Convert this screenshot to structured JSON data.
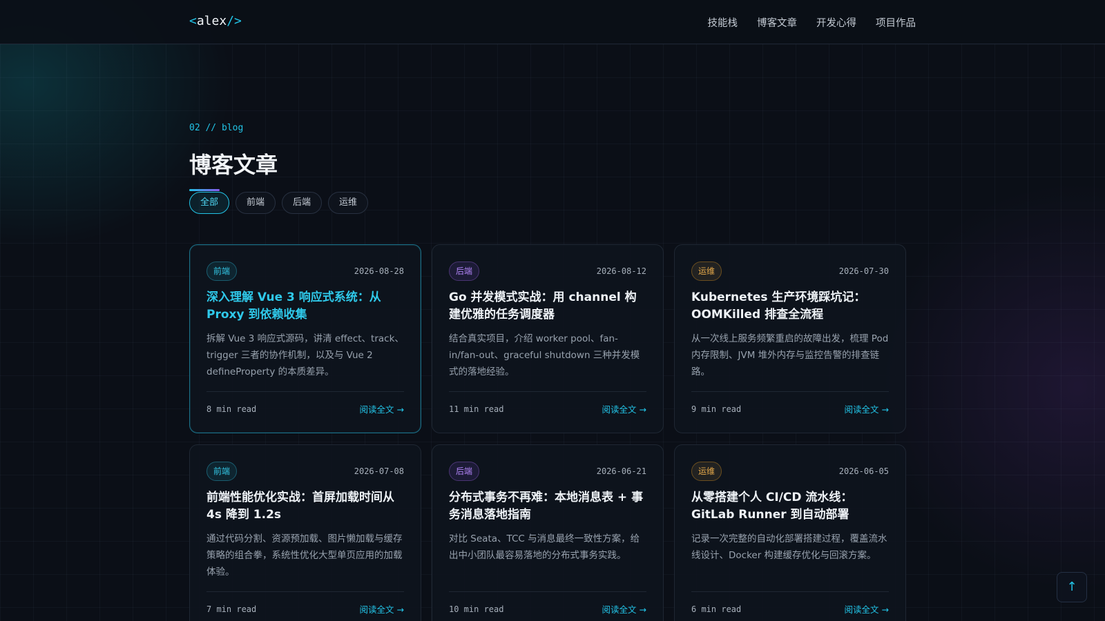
{
  "header": {
    "logo_open": "<",
    "logo_text": "alex",
    "logo_close": "/>",
    "nav": [
      "技能栈",
      "博客文章",
      "开发心得",
      "项目作品"
    ]
  },
  "section": {
    "kicker": "02 // blog",
    "title": "博客文章"
  },
  "filters": [
    {
      "label": "全部",
      "active": true
    },
    {
      "label": "前端",
      "active": false
    },
    {
      "label": "后端",
      "active": false
    },
    {
      "label": "运维",
      "active": false
    }
  ],
  "posts": [
    {
      "tag": "前端",
      "tag_kind": "fe",
      "date": "2026-08-28",
      "title": "深入理解 Vue 3 响应式系统：从 Proxy 到依赖收集",
      "desc": "拆解 Vue 3 响应式源码，讲清 effect、track、trigger 三者的协作机制，以及与 Vue 2 defineProperty 的本质差异。",
      "readtime": "8 min read",
      "readmore": "阅读全文 →",
      "featured": true
    },
    {
      "tag": "后端",
      "tag_kind": "be",
      "date": "2026-08-12",
      "title": "Go 并发模式实战：用 channel 构建优雅的任务调度器",
      "desc": "结合真实项目，介绍 worker pool、fan-in/fan-out、graceful shutdown 三种并发模式的落地经验。",
      "readtime": "11 min read",
      "readmore": "阅读全文 →",
      "featured": false
    },
    {
      "tag": "运维",
      "tag_kind": "ops",
      "date": "2026-07-30",
      "title": "Kubernetes 生产环境踩坑记：OOMKilled 排查全流程",
      "desc": "从一次线上服务频繁重启的故障出发，梳理 Pod 内存限制、JVM 堆外内存与监控告警的排查链路。",
      "readtime": "9 min read",
      "readmore": "阅读全文 →",
      "featured": false
    },
    {
      "tag": "前端",
      "tag_kind": "fe",
      "date": "2026-07-08",
      "title": "前端性能优化实战：首屏加载时间从 4s 降到 1.2s",
      "desc": "通过代码分割、资源预加载、图片懒加载与缓存策略的组合拳，系统性优化大型单页应用的加载体验。",
      "readtime": "7 min read",
      "readmore": "阅读全文 →",
      "featured": false
    },
    {
      "tag": "后端",
      "tag_kind": "be",
      "date": "2026-06-21",
      "title": "分布式事务不再难：本地消息表 + 事务消息落地指南",
      "desc": "对比 Seata、TCC 与消息最终一致性方案，给出中小团队最容易落地的分布式事务实践。",
      "readtime": "10 min read",
      "readmore": "阅读全文 →",
      "featured": false
    },
    {
      "tag": "运维",
      "tag_kind": "ops",
      "date": "2026-06-05",
      "title": "从零搭建个人 CI/CD 流水线：GitLab Runner 到自动部署",
      "desc": "记录一次完整的自动化部署搭建过程，覆盖流水线设计、Docker 构建缓存优化与回滚方案。",
      "readtime": "6 min read",
      "readmore": "阅读全文 →",
      "featured": false
    }
  ],
  "to_top": "↑",
  "colors": {
    "accent": "#22c3e6",
    "purple": "#8b5cf6",
    "amber": "#e6a94a",
    "background": "#0b0f17"
  }
}
